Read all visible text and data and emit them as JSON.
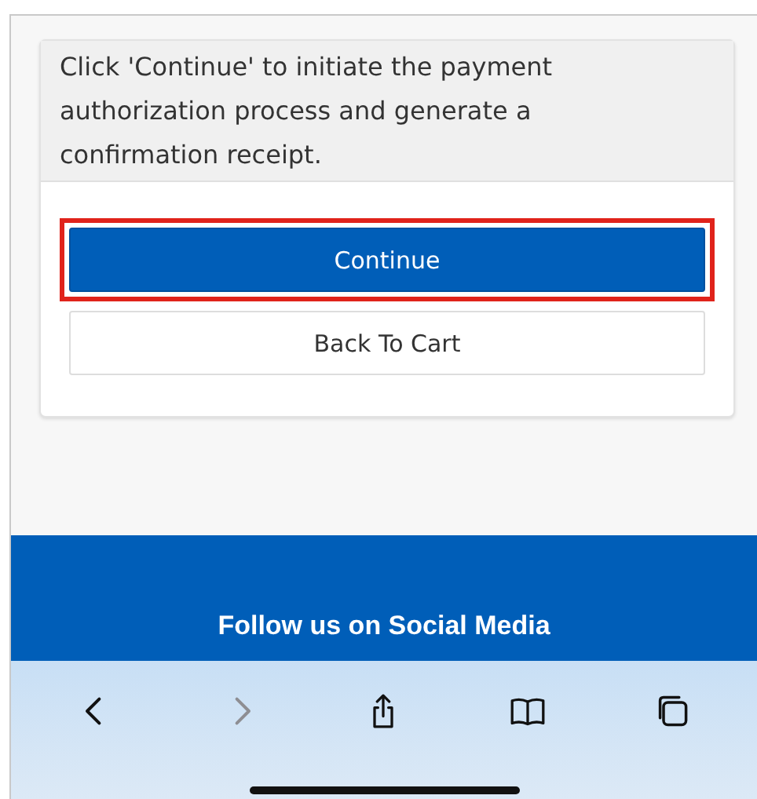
{
  "card": {
    "message": "Click 'Continue' to initiate the payment authorization process and generate a confirmation receipt.",
    "buttons": [
      {
        "label": "Continue",
        "kind": "primary",
        "highlighted": true
      },
      {
        "label": "Back To Cart",
        "kind": "secondary",
        "highlighted": false
      }
    ]
  },
  "footer": {
    "heading": "Follow us on Social Media"
  },
  "browser_toolbar": {
    "buttons": [
      {
        "kind": "back",
        "disabled": false
      },
      {
        "kind": "forward",
        "disabled": true
      },
      {
        "kind": "share",
        "disabled": false
      },
      {
        "kind": "bookmarks",
        "disabled": false
      },
      {
        "kind": "tabs",
        "disabled": false
      }
    ]
  }
}
